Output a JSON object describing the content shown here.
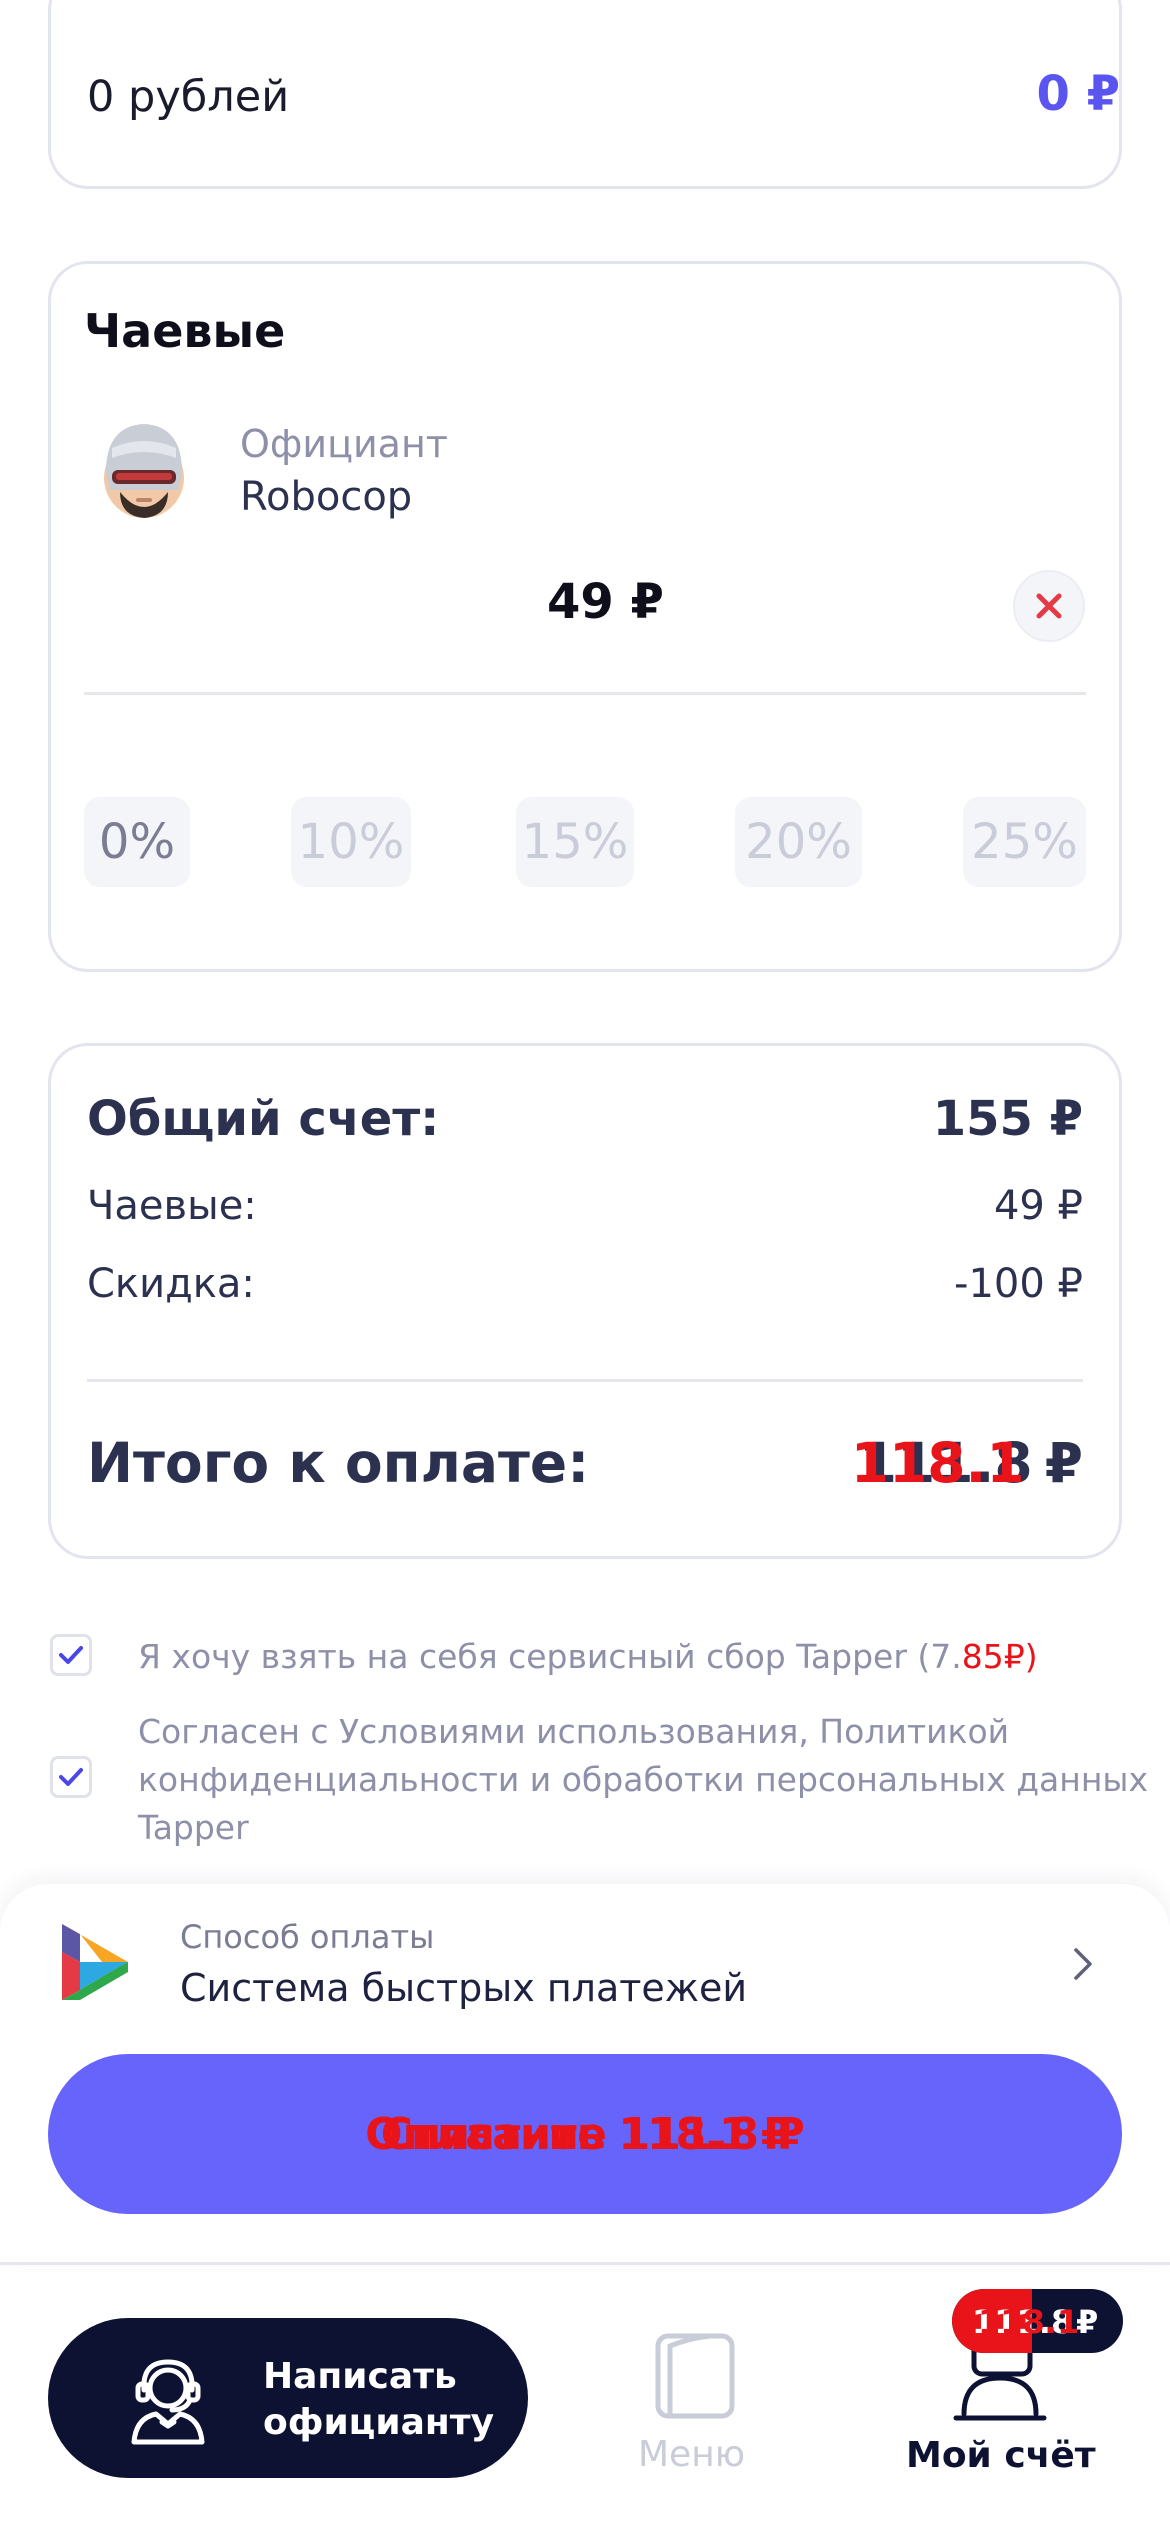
{
  "discount_card": {
    "label": "0 рублей",
    "value": "0 ₽"
  },
  "tips": {
    "title": "Чаевые",
    "waiter_role": "Официант",
    "waiter_name": "Robocop",
    "amount": "49 ₽",
    "percents": [
      "0%",
      "10%",
      "15%",
      "20%",
      "25%"
    ]
  },
  "summary": {
    "total_label": "Общий счет:",
    "total_value": "155 ₽",
    "tips_label": "Чаевые:",
    "tips_value": "49 ₽",
    "discount_label": "Скидка:",
    "discount_value": "-100 ₽",
    "pay_label": "Итого к оплате:",
    "pay_value_a": "111.8",
    "pay_value_b": "118.1",
    "pay_currency": "₽"
  },
  "agreements": {
    "service_fee_text": "Я хочу взять на себя сервисный сбор Tapper (7.",
    "service_fee_tail_a": "85",
    "service_fee_tail_b": "₽)",
    "terms_line1": "Согласен с Условиями использования, Политикой",
    "terms_line2": "конфиденциальности и обработки персональных данных",
    "terms_line3": "Tapper"
  },
  "payment": {
    "method_caption": "Способ оплаты",
    "method_name": "Система быстрых платежей",
    "pay_button_a": "Оплатить 111.8 ₽",
    "pay_button_b": "Списание 118.1 ₽"
  },
  "tabbar": {
    "write_waiter_line1": "Написать",
    "write_waiter_line2": "официанту",
    "menu_label": "Меню",
    "my_bill_label": "Мой счёт",
    "badge_a": "111.8",
    "badge_b": "118.1",
    "badge_currency": "₽"
  },
  "colors": {
    "accent": "#6764fb",
    "dark_navy": "#0d1233",
    "text_primary": "#2d3150",
    "text_muted": "#8d90a8",
    "overlay_red": "#e8141a",
    "close_red": "#e53945"
  }
}
